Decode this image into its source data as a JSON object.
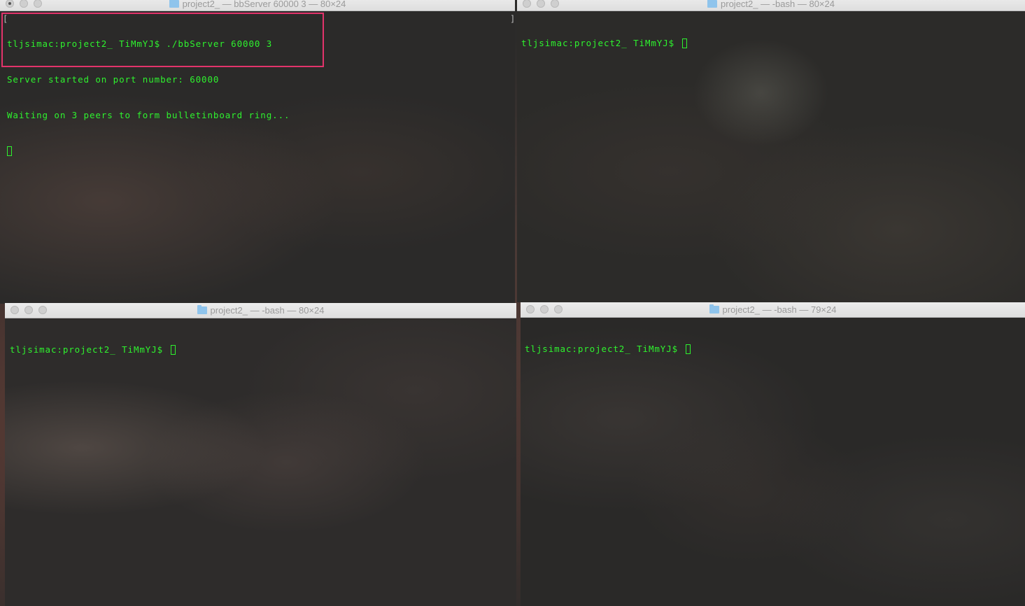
{
  "windows": [
    {
      "id": "top-left",
      "title": "project2_ — bbServer 60000 3 — 80×24",
      "lines": [
        "tljsimac:project2_ TiMmYJ$ ./bbServer 60000 3",
        "Server started on port number: 60000",
        "Waiting on 3 peers to form bulletinboard ring..."
      ],
      "cursor_on_new_line": true
    },
    {
      "id": "top-right",
      "title": "project2_ — -bash — 80×24",
      "prompt": "tljsimac:project2_ TiMmYJ$"
    },
    {
      "id": "bottom-left",
      "title": "project2_ — -bash — 80×24",
      "prompt": "tljsimac:project2_ TiMmYJ$"
    },
    {
      "id": "bottom-right",
      "title": "project2_ — -bash — 79×24",
      "prompt": "tljsimac:project2_ TiMmYJ$"
    }
  ],
  "colors": {
    "terminal_text": "#2ef22e",
    "terminal_bg": "#262626",
    "highlight_box": "#e2336b",
    "titlebar": "#e5e5e5",
    "title_text": "#9a9a9a",
    "folder_icon": "#8fc4ec"
  },
  "icons": {
    "folder": "folder-icon",
    "close": "close-button-icon",
    "minimize": "minimize-button-icon",
    "zoom": "zoom-button-icon"
  }
}
